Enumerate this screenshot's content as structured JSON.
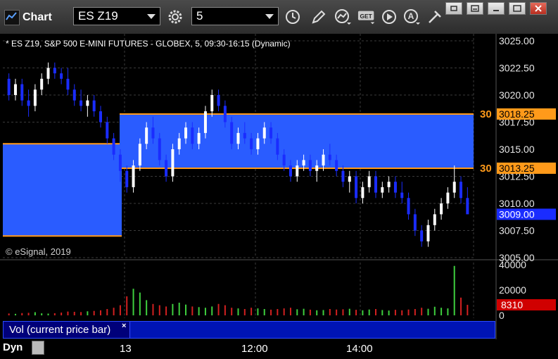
{
  "window": {
    "title": "Chart",
    "symbol": "ES Z19",
    "interval": "5",
    "colors": {
      "titlebar": "#3a3a3a",
      "up_candle": "#ffffff",
      "down_candle": "#1a2cff",
      "band": "#2a5cff",
      "level_line": "#ff9a1a"
    }
  },
  "toolbar": {
    "icons": [
      "settings-icon",
      "clock-icon",
      "pencil-icon",
      "curve-icon",
      "get-icon",
      "play-icon",
      "a-icon",
      "pin-icon"
    ],
    "get_label": "GET"
  },
  "window_controls": [
    "link-icon",
    "restore-small-icon",
    "maximize-icon",
    "close-icon"
  ],
  "chart": {
    "header": "* ES Z19, S&P 500 E-MINI FUTURES - GLOBEX, 5, 09:30-16:15 (Dynamic)",
    "copyright": "© eSignal, 2019",
    "price_axis": [
      "3025.00",
      "3022.50",
      "3020.00",
      "3017.50",
      "3015.00",
      "3012.50",
      "3010.00",
      "3007.50",
      "3005.00"
    ],
    "levels": [
      {
        "tag": "30",
        "price": "3018.25"
      },
      {
        "tag": "30",
        "price": "3013.25"
      }
    ],
    "last_price": "3009.00",
    "volume_axis": [
      "40000",
      "20000",
      "0"
    ],
    "last_volume": "8310",
    "volume_study": "Vol (current price bar)",
    "volume_close": "×",
    "dyn_label": "Dyn",
    "time_axis": [
      "13",
      "12:00",
      "14:00"
    ]
  },
  "chart_data": {
    "type": "candlestick",
    "ylim": [
      3005.0,
      3025.0
    ],
    "volume_ylim": [
      0,
      40000
    ],
    "ohlc": [
      [
        3021.5,
        3022.0,
        3019.5,
        3020.0
      ],
      [
        3020.0,
        3021.5,
        3019.5,
        3021.0
      ],
      [
        3021.0,
        3021.5,
        3019.0,
        3019.5
      ],
      [
        3019.5,
        3020.5,
        3018.0,
        3019.0
      ],
      [
        3019.0,
        3021.0,
        3018.5,
        3020.5
      ],
      [
        3020.5,
        3022.0,
        3020.0,
        3021.5
      ],
      [
        3021.5,
        3023.0,
        3021.0,
        3022.5
      ],
      [
        3022.5,
        3023.0,
        3021.5,
        3022.0
      ],
      [
        3022.0,
        3022.5,
        3021.0,
        3021.5
      ],
      [
        3021.5,
        3022.5,
        3020.0,
        3020.5
      ],
      [
        3020.5,
        3021.0,
        3019.0,
        3019.5
      ],
      [
        3019.5,
        3020.5,
        3018.5,
        3019.0
      ],
      [
        3019.0,
        3020.0,
        3018.0,
        3019.5
      ],
      [
        3019.5,
        3020.0,
        3018.0,
        3018.5
      ],
      [
        3018.5,
        3019.0,
        3017.0,
        3017.5
      ],
      [
        3017.5,
        3018.0,
        3015.5,
        3016.0
      ],
      [
        3016.0,
        3016.5,
        3014.0,
        3014.5
      ],
      [
        3014.5,
        3015.0,
        3012.0,
        3013.0
      ],
      [
        3013.0,
        3013.5,
        3011.0,
        3011.5
      ],
      [
        3011.5,
        3014.0,
        3011.0,
        3013.5
      ],
      [
        3013.5,
        3016.0,
        3013.0,
        3015.5
      ],
      [
        3015.5,
        3017.5,
        3015.0,
        3017.0
      ],
      [
        3017.0,
        3018.0,
        3015.5,
        3016.0
      ],
      [
        3016.0,
        3016.5,
        3013.5,
        3014.0
      ],
      [
        3014.0,
        3014.5,
        3012.0,
        3012.5
      ],
      [
        3012.5,
        3015.5,
        3012.0,
        3015.0
      ],
      [
        3015.0,
        3016.5,
        3014.5,
        3016.0
      ],
      [
        3016.0,
        3017.5,
        3015.5,
        3017.0
      ],
      [
        3017.0,
        3017.5,
        3015.0,
        3015.5
      ],
      [
        3015.5,
        3017.0,
        3015.0,
        3016.5
      ],
      [
        3016.5,
        3019.0,
        3016.0,
        3018.5
      ],
      [
        3018.5,
        3020.5,
        3018.0,
        3020.0
      ],
      [
        3020.0,
        3020.5,
        3018.5,
        3019.0
      ],
      [
        3019.0,
        3019.5,
        3017.0,
        3017.5
      ],
      [
        3017.5,
        3018.0,
        3015.0,
        3015.5
      ],
      [
        3015.5,
        3017.0,
        3015.0,
        3016.5
      ],
      [
        3016.5,
        3017.5,
        3015.5,
        3016.0
      ],
      [
        3016.0,
        3016.5,
        3014.5,
        3015.0
      ],
      [
        3015.0,
        3016.5,
        3014.5,
        3016.0
      ],
      [
        3016.0,
        3017.5,
        3015.5,
        3017.0
      ],
      [
        3017.0,
        3017.5,
        3015.5,
        3016.0
      ],
      [
        3016.0,
        3016.5,
        3014.0,
        3014.5
      ],
      [
        3014.5,
        3015.0,
        3013.0,
        3013.5
      ],
      [
        3013.5,
        3014.0,
        3012.0,
        3012.5
      ],
      [
        3012.5,
        3014.0,
        3012.0,
        3013.5
      ],
      [
        3013.5,
        3014.5,
        3013.0,
        3014.0
      ],
      [
        3014.0,
        3014.5,
        3012.5,
        3013.0
      ],
      [
        3013.0,
        3014.0,
        3012.0,
        3013.5
      ],
      [
        3013.5,
        3015.0,
        3013.0,
        3014.5
      ],
      [
        3014.5,
        3015.5,
        3013.5,
        3014.0
      ],
      [
        3014.0,
        3014.5,
        3012.5,
        3013.0
      ],
      [
        3013.0,
        3013.5,
        3011.5,
        3012.0
      ],
      [
        3012.0,
        3013.0,
        3011.0,
        3012.5
      ],
      [
        3012.5,
        3013.0,
        3010.0,
        3010.5
      ],
      [
        3010.5,
        3012.0,
        3010.0,
        3011.5
      ],
      [
        3011.5,
        3013.0,
        3011.0,
        3012.5
      ],
      [
        3012.5,
        3013.0,
        3010.5,
        3011.0
      ],
      [
        3011.0,
        3012.0,
        3010.5,
        3011.5
      ],
      [
        3011.5,
        3012.5,
        3011.0,
        3012.0
      ],
      [
        3012.0,
        3012.5,
        3010.5,
        3011.0
      ],
      [
        3011.0,
        3012.0,
        3010.0,
        3010.5
      ],
      [
        3010.5,
        3011.0,
        3008.5,
        3009.0
      ],
      [
        3009.0,
        3009.5,
        3007.0,
        3007.5
      ],
      [
        3007.5,
        3008.0,
        3006.0,
        3006.5
      ],
      [
        3006.5,
        3008.5,
        3006.0,
        3008.0
      ],
      [
        3008.0,
        3009.5,
        3007.5,
        3009.0
      ],
      [
        3009.0,
        3010.5,
        3008.5,
        3010.0
      ],
      [
        3010.0,
        3011.5,
        3009.5,
        3011.0
      ],
      [
        3011.0,
        3013.5,
        3010.5,
        3012.0
      ],
      [
        3012.0,
        3012.5,
        3010.0,
        3010.5
      ],
      [
        3010.5,
        3011.5,
        3009.5,
        3009.0
      ]
    ],
    "volume": [
      1500,
      1200,
      1800,
      2000,
      2500,
      1600,
      1400,
      1700,
      2200,
      3000,
      2800,
      2600,
      3200,
      3500,
      4000,
      5000,
      6000,
      8000,
      15000,
      21000,
      18000,
      12000,
      9000,
      8000,
      7000,
      9000,
      10000,
      8500,
      7000,
      6500,
      6000,
      7000,
      9000,
      8000,
      6000,
      5500,
      5000,
      6000,
      5500,
      5000,
      4500,
      5000,
      5500,
      6000,
      4800,
      5200,
      4500,
      4000,
      4200,
      5000,
      4600,
      4800,
      5200,
      4400,
      4000,
      4600,
      5000,
      4200,
      3800,
      4400,
      4000,
      4600,
      5000,
      6000,
      5200,
      6800,
      6000,
      5500,
      39000,
      14000,
      8310
    ],
    "levels": [
      3018.25,
      3013.25
    ],
    "prior_band": [
      3015.5,
      3007.0
    ]
  }
}
